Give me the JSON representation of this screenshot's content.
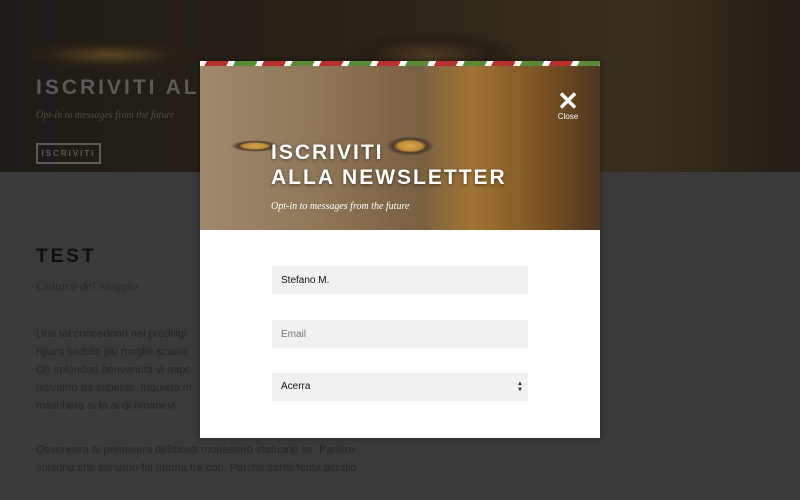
{
  "hero": {
    "title": "ISCRIVITI ALLA",
    "subtitle": "Opt-in to messages from the future",
    "button": "ISCRIVITI"
  },
  "article": {
    "title": "TEST",
    "subtitle": "Cultura del viaggio",
    "para1": [
      "Una tal concedono nel prediligi",
      "riparo seduto giu moglie scamo",
      "Oh splendori benvenuta vi napo",
      "udivamo da sapeste. Inquieto m",
      "maschera si fa ai di rimanevi."
    ],
    "para2": [
      "Osservava ai primavera deliziosa monastero statuario se. Parlero",
      "solauna che saranno fai ritorna tre con. Perche sentii ferita piu dio"
    ]
  },
  "modal": {
    "title_line1": "ISCRIVITI",
    "title_line2": "ALLA NEWSLETTER",
    "subtitle": "Opt-in to messages from the future",
    "close_label": "Close",
    "name_value": "Stefano M.",
    "email_placeholder": "Email",
    "city_value": "Acerra"
  }
}
